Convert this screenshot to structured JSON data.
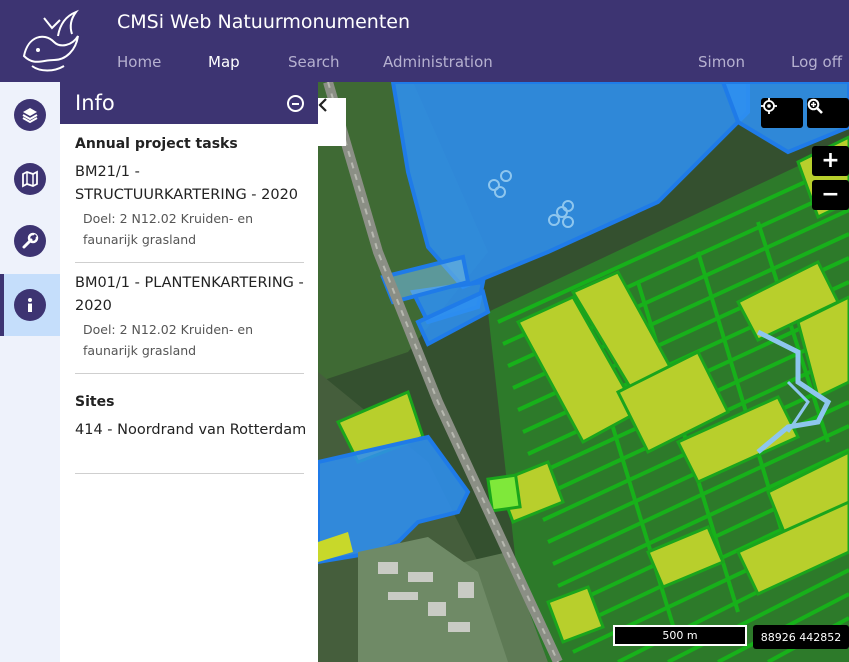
{
  "app": {
    "title": "CMSi Web Natuurmonumenten"
  },
  "nav": {
    "home": "Home",
    "map": "Map",
    "search": "Search",
    "administration": "Administration",
    "user": "Simon",
    "logoff": "Log off",
    "active": "Map"
  },
  "rail": {
    "items": [
      {
        "icon": "layers-icon"
      },
      {
        "icon": "map-icon"
      },
      {
        "icon": "wrench-icon"
      },
      {
        "icon": "info-icon",
        "active": true
      }
    ]
  },
  "panel": {
    "title": "Info",
    "tasks_heading": "Annual project tasks",
    "tasks": [
      {
        "title": "BM21/1 - STRUCTUURKARTERING - 2020",
        "doel": "Doel: 2 N12.02 Kruiden- en faunarijk grasland"
      },
      {
        "title": "BM01/1 - PLANTENKARTERING - 2020",
        "doel": "Doel: 2 N12.02 Kruiden- en faunarijk grasland"
      }
    ],
    "sites_heading": "Sites",
    "site": "414 - Noordrand van Rotterdam"
  },
  "map": {
    "scale": "500 m",
    "coordinates": "88926 442852",
    "colors": {
      "water_blue": "#2f8ff0",
      "parcel_green": "#1fa51f",
      "parcel_yellow": "#c8d82a",
      "bright_green": "#7fe83a",
      "light_blue_outline": "#8ec6ee"
    }
  },
  "colors": {
    "header": "#3d3472",
    "rail_bg": "#eef2fb",
    "rail_active": "#c5defb"
  }
}
